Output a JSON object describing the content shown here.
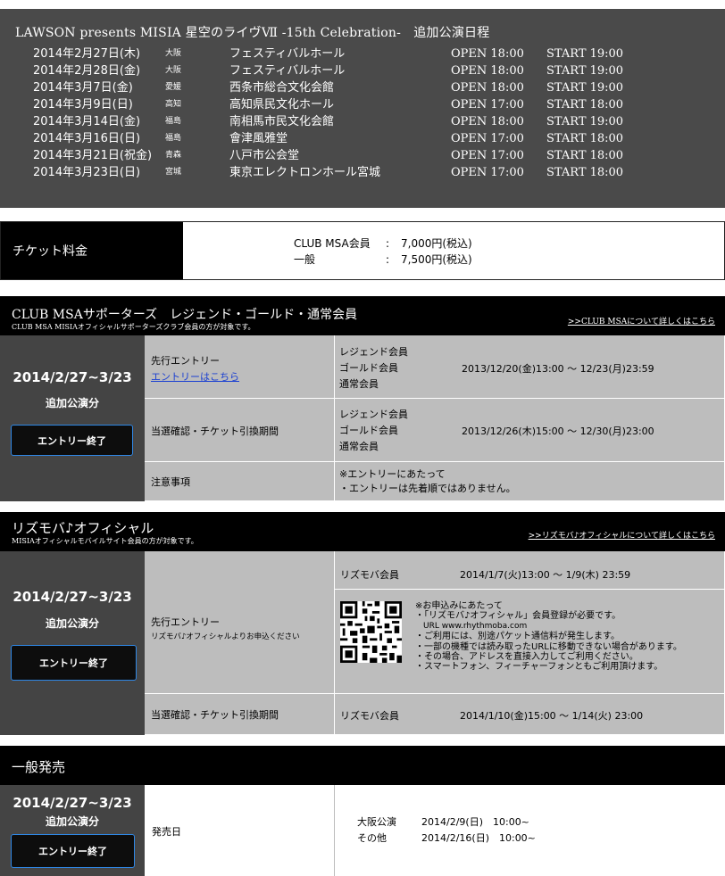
{
  "schedule": {
    "title": "LAWSON presents MISIA 星空のライヴⅦ -15th Celebration-　追加公演日程",
    "rows": [
      {
        "date": "2014年2月27日(木)",
        "pref": "大阪",
        "venue": "フェスティバルホール",
        "open": "OPEN 18:00",
        "start": "START 19:00"
      },
      {
        "date": "2014年2月28日(金)",
        "pref": "大阪",
        "venue": "フェスティバルホール",
        "open": "OPEN 18:00",
        "start": "START 19:00"
      },
      {
        "date": "2014年3月7日(金)",
        "pref": "愛媛",
        "venue": "西条市総合文化会館",
        "open": "OPEN 18:00",
        "start": "START 19:00"
      },
      {
        "date": "2014年3月9日(日)",
        "pref": "高知",
        "venue": "高知県民文化ホール",
        "open": "OPEN 17:00",
        "start": "START 18:00"
      },
      {
        "date": "2014年3月14日(金)",
        "pref": "福島",
        "venue": "南相馬市民文化会館",
        "open": "OPEN 18:00",
        "start": "START 19:00"
      },
      {
        "date": "2014年3月16日(日)",
        "pref": "福島",
        "venue": "會津風雅堂",
        "open": "OPEN 17:00",
        "start": "START 18:00"
      },
      {
        "date": "2014年3月21日(祝金)",
        "pref": "青森",
        "venue": "八戸市公会堂",
        "open": "OPEN 17:00",
        "start": "START 18:00"
      },
      {
        "date": "2014年3月23日(日)",
        "pref": "宮城",
        "venue": "東京エレクトロンホール宮城",
        "open": "OPEN 17:00",
        "start": "START 18:00"
      }
    ]
  },
  "price": {
    "label": "チケット料金",
    "items": [
      {
        "name": "CLUB MSA会員",
        "colon": ":",
        "value": "7,000円(税込)"
      },
      {
        "name": "一般",
        "colon": ":",
        "value": "7,500円(税込)"
      }
    ]
  },
  "club": {
    "title": "CLUB MSAサポーターズ　レジェンド・ゴールド・通常会員",
    "subtitle": "CLUB MSA MISIAオフィシャルサポーターズクラブ会員の方が対象です。",
    "link": ">>CLUB MSAについて詳しくはこちら",
    "side_date": "2014/2/27~3/23",
    "side_add": "追加公演分",
    "button": "エントリー終了",
    "row1_label": "先行エントリー",
    "row1_link": "エントリーはこちら",
    "row1_members": [
      "レジェンド会員",
      "ゴールド会員",
      "通常会員"
    ],
    "row1_period": "2013/12/20(金)13:00 ～ 12/23(月)23:59",
    "row2_label": "当選確認・チケット引換期間",
    "row2_members": [
      "レジェンド会員",
      "ゴールド会員",
      "通常会員"
    ],
    "row2_period": "2013/12/26(木)15:00 ～ 12/30(月)23:00",
    "row3_label": "注意事項",
    "row3_notes": [
      "※エントリーにあたって",
      "・エントリーは先着順ではありません。"
    ]
  },
  "rhythm": {
    "title": "リズモバ♪オフィシャル",
    "subtitle": "MISIAオフィシャルモバイルサイト会員の方が対象です。",
    "link": ">>リズモバ♪オフィシャルについて詳しくはこちら",
    "side_date": "2014/2/27~3/23",
    "side_add": "追加公演分",
    "button": "エントリー終了",
    "row1_label": "先行エントリー",
    "row1_sub": "リズモバ♪オフィシャルよりお申込ください",
    "row1_member": "リズモバ会員",
    "row1_period": "2014/1/7(火)13:00 ～ 1/9(木) 23:59",
    "notes": [
      "※お申込みにあたって",
      "・「リズモバ♪オフィシャル」会員登録が必要です。",
      "URL www.rhythmoba.com",
      "・ご利用には、別途パケット通信料が発生します。",
      "・一部の機種では読み取ったURLに移動できない場合があります。",
      "・その場合、アドレスを直接入力してご利用ください。",
      "・スマートフォン、フィーチャーフォンともご利用頂けます。"
    ],
    "row2_label": "当選確認・チケット引換期間",
    "row2_member": "リズモバ会員",
    "row2_period": "2014/1/10(金)15:00 ～ 1/14(火) 23:00"
  },
  "general": {
    "title": "一般発売",
    "side_date": "2014/2/27~3/23",
    "side_add": "追加公演分",
    "button": "エントリー終了",
    "label": "発売日",
    "rows": [
      {
        "place": "大阪公演",
        "date": "2014/2/9(日)　10:00~"
      },
      {
        "place": "その他",
        "date": "2014/2/16(日)　10:00~"
      }
    ]
  }
}
